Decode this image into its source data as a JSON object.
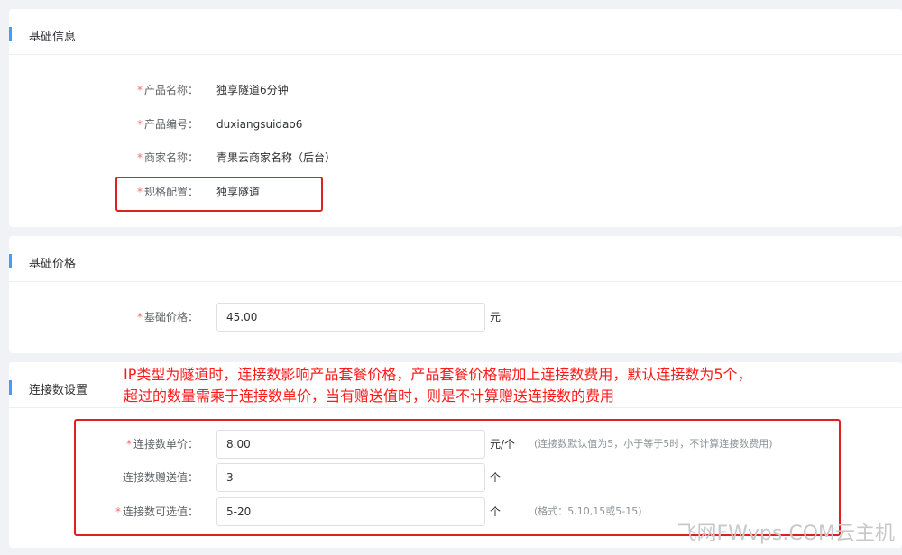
{
  "sections": {
    "basic_info": {
      "title": "基础信息",
      "fields": [
        {
          "label": "产品名称：",
          "required": "*",
          "value": "独享隧道6分钟"
        },
        {
          "label": "产品编号：",
          "required": "*",
          "value": "duxiangsuidao6"
        },
        {
          "label": "商家名称：",
          "required": "*",
          "value": "青果云商家名称（后台）"
        },
        {
          "label": "规格配置：",
          "required": "*",
          "value": "独享隧道"
        }
      ]
    },
    "basic_price": {
      "title": "基础价格",
      "field": {
        "label": "基础价格：",
        "required": "*",
        "value": "45.00",
        "unit": "元"
      }
    },
    "connection": {
      "title": "连接数设置",
      "fields": [
        {
          "label": "连接数单价：",
          "required": "*",
          "value": "8.00",
          "unit": "元/个",
          "hint": "(连接数默认值为5，小于等于5时，不计算连接数费用)"
        },
        {
          "label": "连接数赠送值：",
          "required": "",
          "value": "3",
          "unit": "个",
          "hint": ""
        },
        {
          "label": "连接数可选值：",
          "required": "*",
          "value": "5-20",
          "unit": "个",
          "hint": "(格式：5,10,15或5-15)"
        }
      ]
    }
  },
  "annotation": {
    "line1": "IP类型为隧道时，连接数影响产品套餐价格，产品套餐价格需加上连接数费用，默认连接数为5个，",
    "line2": "超过的数量需乘于连接数单价，当有赠送值时，则是不计算赠送连接数的费用"
  },
  "watermark": "飞网FWvps.COM云主机",
  "colors": {
    "accent": "#409eff",
    "required": "#f56c6c",
    "annotation": "#ff1a1a",
    "highlight_box": "#e02020"
  }
}
